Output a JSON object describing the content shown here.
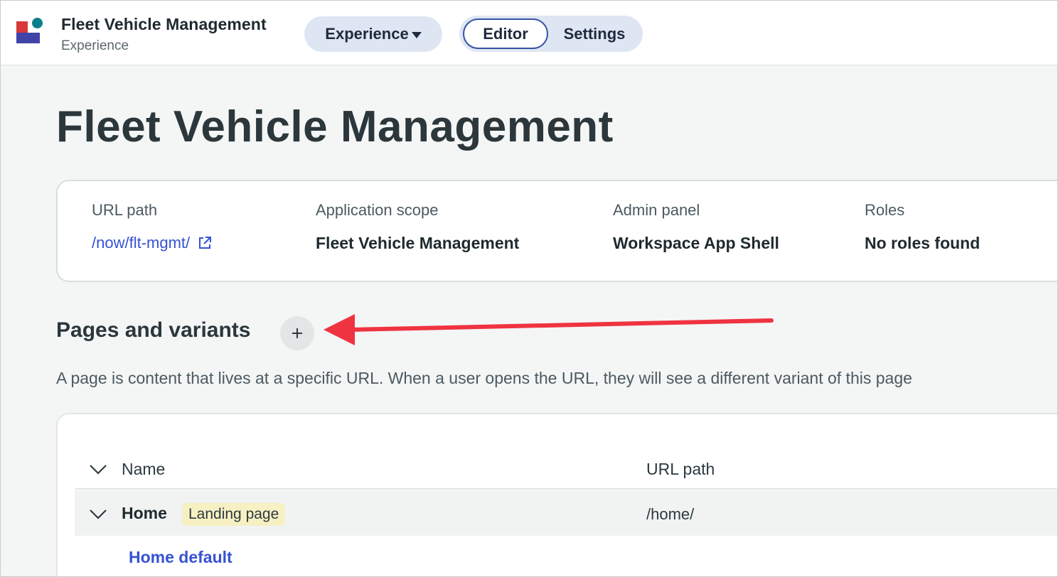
{
  "header": {
    "app_title": "Fleet Vehicle Management",
    "app_subtitle": "Experience",
    "experience_menu": "Experience",
    "tabs": [
      {
        "label": "Editor",
        "active": true
      },
      {
        "label": "Settings",
        "active": false
      }
    ]
  },
  "main": {
    "page_title": "Fleet Vehicle Management",
    "info": {
      "url_path_label": "URL path",
      "url_path_value": "/now/flt-mgmt/",
      "scope_label": "Application scope",
      "scope_value": "Fleet Vehicle Management",
      "admin_label": "Admin panel",
      "admin_value": "Workspace App Shell",
      "roles_label": "Roles",
      "roles_value": "No roles found"
    },
    "pages_section": {
      "title": "Pages and variants",
      "add_symbol": "+",
      "description": "A page is content that lives at a specific URL. When a user opens the URL, they will see a different variant of this page"
    },
    "table": {
      "columns": [
        "Name",
        "URL path"
      ],
      "rows": [
        {
          "name": "Home",
          "badge": "Landing page",
          "url": "/home/",
          "variants": [
            "Home default"
          ]
        }
      ]
    }
  },
  "colors": {
    "accent": "#3552d4",
    "annotation_arrow": "#ef3340",
    "badge_bg": "#f7f0c2"
  },
  "icons": [
    "app-logo",
    "chevron-down-icon",
    "external-link-icon",
    "plus-icon",
    "annotation-arrow"
  ]
}
